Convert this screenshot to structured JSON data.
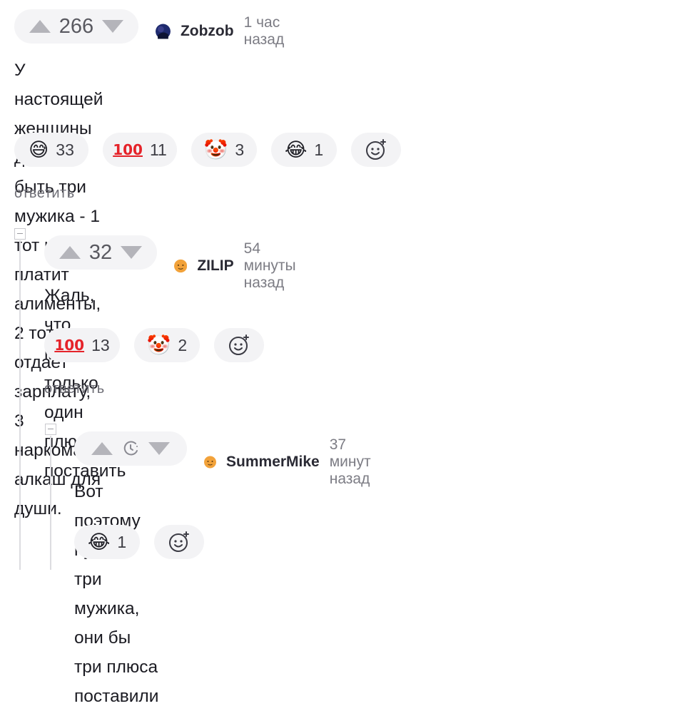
{
  "comments": [
    {
      "rating": "266",
      "author": "Zobzob",
      "time": "1 час назад",
      "text_line1": "У настоящей женщины должно быть три мужика - 1 тот кто платит алименты,",
      "text_line2": "2 тот кто отдает  зарплату, 3 наркоман алкаш для души.",
      "reactions": [
        {
          "icon": "grinning-sweat-emoji",
          "glyph": "😅",
          "count": "33"
        },
        {
          "icon": "hundred-points-emoji",
          "glyph": "100",
          "count": "11"
        },
        {
          "icon": "clown-emoji",
          "glyph": "🤡",
          "count": "3"
        },
        {
          "icon": "tears-of-joy-emoji",
          "glyph": "😂",
          "count": "1"
        }
      ],
      "reply_label": "ответить"
    },
    {
      "rating": "32",
      "author": "ZILIP",
      "time": "54 минуты назад",
      "text_line1": "Жаль, что можно только один плюс поставить",
      "reactions": [
        {
          "icon": "hundred-points-emoji",
          "glyph": "100",
          "count": "13"
        },
        {
          "icon": "clown-emoji",
          "glyph": "🤡",
          "count": "2"
        }
      ],
      "reply_label": "ответить"
    },
    {
      "rating": "",
      "author": "SummerMike",
      "time": "37 минут назад",
      "text_line1": "Вот поэтому нужны три мужика, они бы три плюса поставили",
      "reactions": [
        {
          "icon": "tears-of-joy-emoji",
          "glyph": "😂",
          "count": "1"
        }
      ]
    }
  ],
  "colors": {
    "pill_bg": "#f4f4f6",
    "arrow": "#b4b4ba",
    "accent_red": "#e5232a",
    "avatar_orange": "#f2a23a",
    "avatar_dark": "#1e2a6e"
  }
}
